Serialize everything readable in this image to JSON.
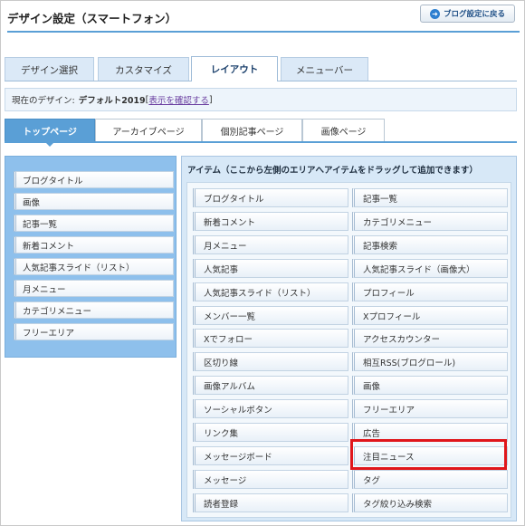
{
  "header": {
    "title": "デザイン設定（スマートフォン）",
    "back_button": "ブログ設定に戻る",
    "back_icon": "arrow-circle-icon"
  },
  "main_tabs": [
    {
      "label": "デザイン選択",
      "active": false
    },
    {
      "label": "カスタマイズ",
      "active": false
    },
    {
      "label": "レイアウト",
      "active": true
    },
    {
      "label": "メニューバー",
      "active": false
    }
  ],
  "current_design": {
    "prefix": "現在のデザイン:",
    "name": "デフォルト2019",
    "open_bracket": "[",
    "link": "表示を確認する",
    "close_bracket": "]"
  },
  "sub_tabs": [
    {
      "label": "トップページ",
      "active": true
    },
    {
      "label": "アーカイブページ",
      "active": false
    },
    {
      "label": "個別記事ページ",
      "active": false
    },
    {
      "label": "画像ページ",
      "active": false
    }
  ],
  "left_items": [
    "ブログタイトル",
    "画像",
    "記事一覧",
    "新着コメント",
    "人気記事スライド（リスト）",
    "月メニュー",
    "カテゴリメニュー",
    "フリーエリア"
  ],
  "items_panel": {
    "title": "アイテム（ここから左側のエリアへアイテムをドラッグして追加できます）",
    "items": [
      "ブログタイトル",
      "記事一覧",
      "新着コメント",
      "カテゴリメニュー",
      "月メニュー",
      "記事検索",
      "人気記事",
      "人気記事スライド（画像大）",
      "人気記事スライド（リスト）",
      "プロフィール",
      "メンバー一覧",
      "Xプロフィール",
      "Xでフォロー",
      "アクセスカウンター",
      "区切り線",
      "相互RSS(ブログロール)",
      "画像アルバム",
      "画像",
      "ソーシャルボタン",
      "フリーエリア",
      "リンク集",
      "広告",
      "メッセージボード",
      "注目ニュース",
      "メッセージ",
      "タグ",
      "読者登録",
      "タグ絞り込み検索"
    ],
    "highlighted_item": "注目ニュース"
  },
  "colors": {
    "accent": "#5a9fd6",
    "highlight": "#e0161b",
    "left_panel": "#8ec0ec"
  }
}
